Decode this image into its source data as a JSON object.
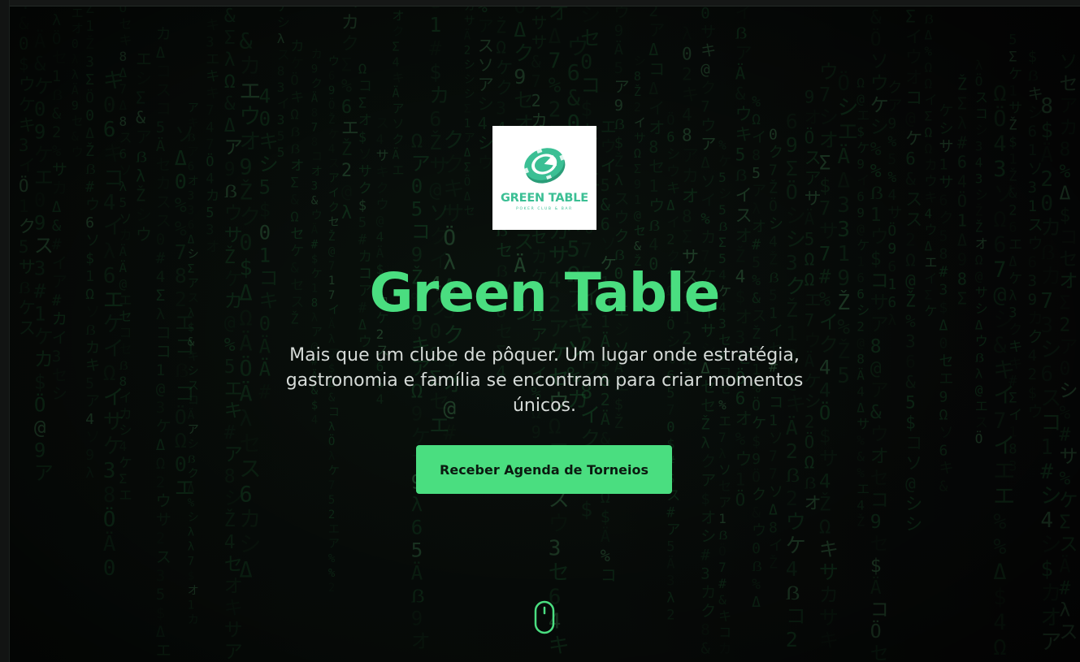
{
  "brand": {
    "logo_text": "GREEN TABLE",
    "logo_subtext": "POKER CLUB & BAR"
  },
  "hero": {
    "title": "Green Table",
    "subtitle": "Mais que um clube de pôquer. Um lugar onde estratégia, gastronomia e família se encontram para criar momentos únicos.",
    "cta_label": "Receber Agenda de Torneios",
    "scroll_indicator": "mouse-icon"
  },
  "colors": {
    "accent": "#4ade80",
    "logo": "#3bbf94",
    "background": "#0b0d0c",
    "text": "#d6dbd8"
  }
}
